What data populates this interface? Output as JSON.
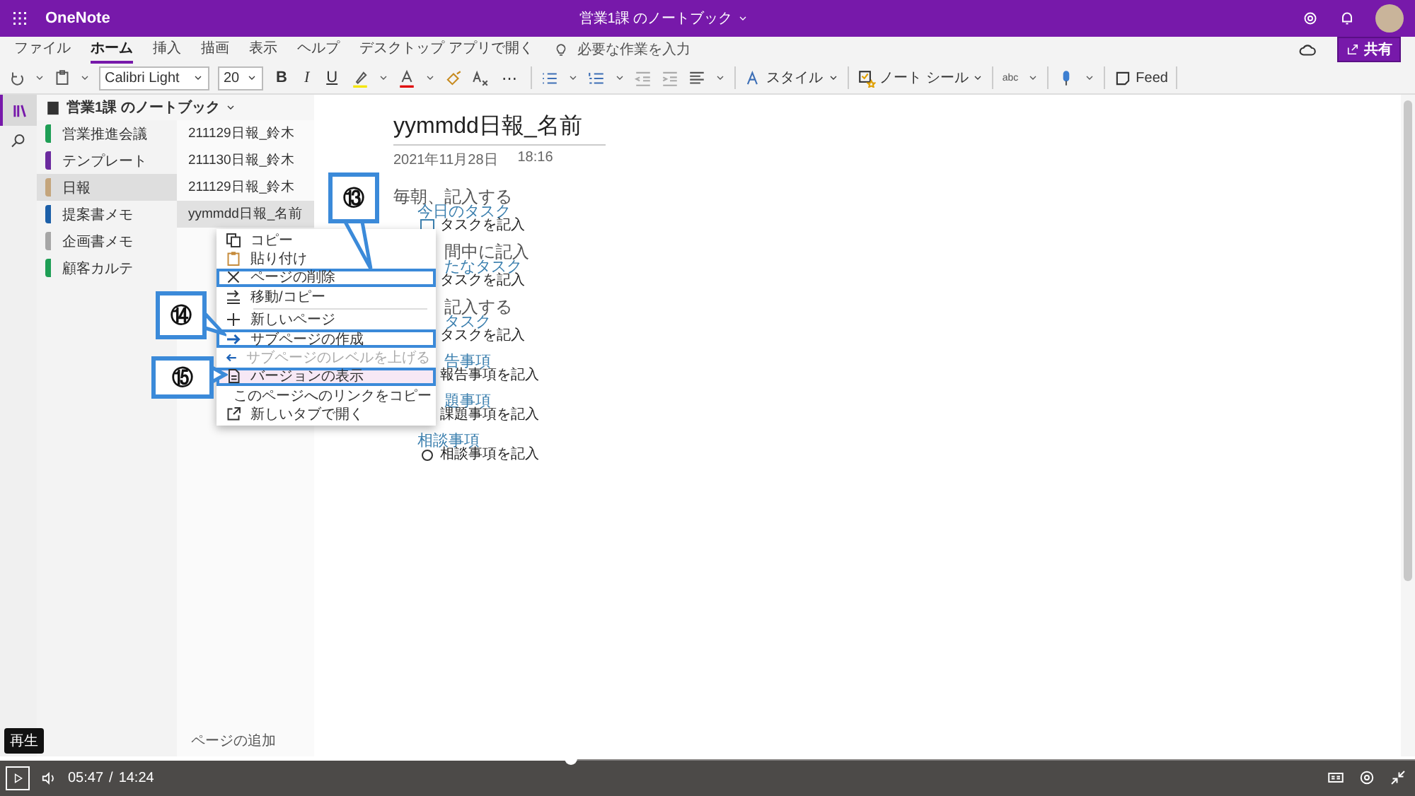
{
  "app_bar": {
    "app_name": "OneNote",
    "title": "営業1課 のノートブック"
  },
  "menu_tabs": [
    {
      "label": "ファイル",
      "selected": false
    },
    {
      "label": "ホーム",
      "selected": true
    },
    {
      "label": "挿入",
      "selected": false
    },
    {
      "label": "描画",
      "selected": false
    },
    {
      "label": "表示",
      "selected": false
    },
    {
      "label": "ヘルプ",
      "selected": false
    }
  ],
  "open_desktop": "デスクトップ アプリで開く",
  "tell_me": {
    "placeholder": "必要な作業を入力"
  },
  "share_button": "共有",
  "toolbar": {
    "font": "Calibri Light",
    "size": "20",
    "bold": "B",
    "italic": "I",
    "underline": "U",
    "more": "⋯",
    "styles": "スタイル",
    "note_tags": "ノート シール",
    "spelling": "abc",
    "feed": "Feed"
  },
  "notebook": "営業1課 のノートブック",
  "sections": [
    {
      "name": "営業推進会議",
      "color": "#1e9e55",
      "selected": false
    },
    {
      "name": "テンプレート",
      "color": "#6b2a9e",
      "selected": false
    },
    {
      "name": "日報",
      "color": "#c4a57c",
      "selected": true
    },
    {
      "name": "提案書メモ",
      "color": "#1c5fa8",
      "selected": false
    },
    {
      "name": "企画書メモ",
      "color": "#a6a6a6",
      "selected": false
    },
    {
      "name": "顧客カルテ",
      "color": "#1e9e55",
      "selected": false
    }
  ],
  "pages": [
    {
      "title": "211129日報_鈴木",
      "selected": false
    },
    {
      "title": "211130日報_鈴木",
      "selected": false
    },
    {
      "title": "211129日報_鈴木",
      "selected": false
    },
    {
      "title": "yymmdd日報_名前",
      "selected": true
    }
  ],
  "add_page": "ページの追加",
  "page": {
    "title": "yymmdd日報_名前",
    "date": "2021年11月28日",
    "time": "18:16",
    "groups": [
      {
        "partial": false,
        "lines": [
          {
            "kind": "title",
            "text": "毎朝、記入する"
          },
          {
            "kind": "subtitle",
            "text": "今日のタスク"
          },
          {
            "kind": "task",
            "text": "タスクを記入",
            "checked": false
          }
        ]
      },
      {
        "partial": true,
        "lines": [
          {
            "kind": "title",
            "text": "間中に記入"
          },
          {
            "kind": "subtitle",
            "text": "たなタスク"
          },
          {
            "kind": "task",
            "text": "タスクを記入"
          }
        ]
      },
      {
        "partial": true,
        "lines": [
          {
            "kind": "title",
            "text": "記入する"
          },
          {
            "kind": "subtitle",
            "text": "タスク"
          },
          {
            "kind": "task",
            "text": "タスクを記入"
          }
        ]
      },
      {
        "partial": true,
        "lines": [
          {
            "kind": "subtitle",
            "text": "告事項"
          },
          {
            "kind": "bullet",
            "text": "報告事項を記入"
          }
        ]
      },
      {
        "partial": true,
        "lines": [
          {
            "kind": "subtitle",
            "text": "題事項"
          },
          {
            "kind": "bullet",
            "text": "課題事項を記入"
          }
        ]
      },
      {
        "partial": false,
        "lines": [
          {
            "kind": "subtitle",
            "text": "相談事項"
          },
          {
            "kind": "bullet",
            "text": "相談事項を記入"
          }
        ]
      }
    ]
  },
  "context_menu": [
    {
      "kind": "item",
      "label": "コピー",
      "disabled": false,
      "highlighted": false,
      "hovered": false
    },
    {
      "kind": "item",
      "label": "貼り付け",
      "disabled": false,
      "highlighted": false,
      "hovered": false
    },
    {
      "kind": "item",
      "label": "ページの削除",
      "disabled": false,
      "highlighted": true,
      "hovered": false
    },
    {
      "kind": "item",
      "label": "移動/コピー",
      "disabled": false,
      "highlighted": false,
      "hovered": false
    },
    {
      "kind": "separator"
    },
    {
      "kind": "item",
      "label": "新しいページ",
      "disabled": false,
      "highlighted": false,
      "hovered": false
    },
    {
      "kind": "item",
      "label": "サブページの作成",
      "disabled": false,
      "highlighted": true,
      "hovered": false
    },
    {
      "kind": "item",
      "label": "サブページのレベルを上げる",
      "disabled": true,
      "highlighted": false,
      "hovered": false
    },
    {
      "kind": "item",
      "label": "バージョンの表示",
      "disabled": false,
      "highlighted": true,
      "hovered": true
    },
    {
      "kind": "item",
      "label": "このページへのリンクをコピー",
      "disabled": false,
      "highlighted": false,
      "hovered": false
    },
    {
      "kind": "item",
      "label": "新しいタブで開く",
      "disabled": false,
      "highlighted": false,
      "hovered": false
    }
  ],
  "callouts": [
    "⑬",
    "⑭",
    "⑮"
  ],
  "player": {
    "tooltip": "再生",
    "current": "05:47",
    "separator": "/",
    "duration": "14:24",
    "level": 0.403
  }
}
